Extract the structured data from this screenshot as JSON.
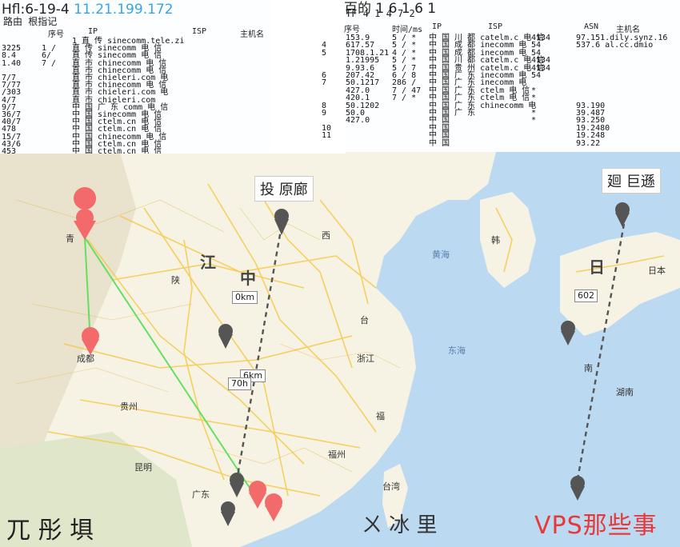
{
  "left_panel": {
    "title": "Hfl:6-19-4",
    "ip": "11.21.199.172",
    "subtitle": "路由 根指记",
    "headers": [
      "序号",
      "IP",
      "ISP",
      "主机名"
    ],
    "rows": [
      {
        "c1": "",
        "c2": "",
        "c3": "",
        "c4": "1 直 传 sinecomm.tele.zi"
      },
      {
        "c1": "3225",
        "c2": "1 /",
        "c3": "",
        "c4": "直 传 sinecomm 电 信"
      },
      {
        "c1": "8.4",
        "c2": "6/",
        "c3": "",
        "c4": "直 传 sinecomm 电 信"
      },
      {
        "c1": "1.40",
        "c2": "7 /",
        "c3": "",
        "c4": "直 市 chinecomm 电 信"
      },
      {
        "c1": "",
        "c2": "",
        "c3": "",
        "c4": "直 市 chinecomm 电 信"
      },
      {
        "c1": "7/7",
        "c2": "",
        "c3": "",
        "c4": "直 市 chieleri.com 电"
      },
      {
        "c1": "7/77",
        "c2": "",
        "c3": "",
        "c4": "直 市 chinecomm 电 信"
      },
      {
        "c1": "/303",
        "c2": "",
        "c3": "",
        "c4": "直 市 chieleri.com 电"
      },
      {
        "c1": "4/7",
        "c2": "",
        "c3": "",
        "c4": "直 市 chieleri.com"
      },
      {
        "c1": "9/7",
        "c2": "",
        "c3": "",
        "c4": "中 国 广 东 comm 电 信"
      },
      {
        "c1": "36/7",
        "c2": "",
        "c3": "",
        "c4": "中 国 sinecomm 电 信"
      },
      {
        "c1": "40/7",
        "c2": "",
        "c3": "",
        "c4": "中 国 ctelm.cn 电 信"
      },
      {
        "c1": "478",
        "c2": "",
        "c3": "",
        "c4": "中 国 ctelm.cn 电 信"
      },
      {
        "c1": "15/7",
        "c2": "",
        "c3": "",
        "c4": "中 国 chinecomm 电 信"
      },
      {
        "c1": "43/6",
        "c2": "",
        "c3": "",
        "c4": "中 国 ctelm.cn 电 信"
      },
      {
        "c1": "453",
        "c2": "",
        "c3": "",
        "c4": "中 国 ctelm.cn 电 信"
      }
    ]
  },
  "right_panel": {
    "title": "百的 1 6 1 6 1",
    "subtitle": "TF 4 1 4 7 2",
    "headers": [
      "序号",
      "时间/ms",
      "IP",
      "ISP",
      "ASN",
      "主机名"
    ],
    "rows": [
      {
        "n": "",
        "t": "153.9",
        "ip": "5 / *",
        "isp": "中 国 川 都 catelm.c 电 信",
        "asn": "4134",
        "host": "97.151.dily.synz.16"
      },
      {
        "n": "4",
        "t": "617.57",
        "ip": "5 / *",
        "isp": "中 国 成 都 inecomm 电",
        "asn": "54",
        "host": "537.6 al.cc.dmio"
      },
      {
        "n": "5",
        "t": "1708.1.21",
        "ip": "4 / *",
        "isp": "中 国 成 都 inecomm 电",
        "asn": "54",
        "host": ""
      },
      {
        "n": "",
        "t": "1.21995",
        "ip": "5 / *",
        "isp": "中 国 川 都 catelm.c 电 信",
        "asn": "4134",
        "host": ""
      },
      {
        "n": "",
        "t": "9.93.6",
        "ip": "5 / 7",
        "isp": "中 国 贵 州 catelm.c 电 信",
        "asn": "4134",
        "host": ""
      },
      {
        "n": "6",
        "t": "207.42",
        "ip": "6 / 8",
        "isp": "中 国 广 东 inecomm 电",
        "asn": "54",
        "host": ""
      },
      {
        "n": "7",
        "t": "50.1217",
        "ip": "286 /",
        "isp": "中 国 广 东 inecomm 电",
        "asn": "",
        "host": ""
      },
      {
        "n": "",
        "t": "427.0",
        "ip": "7 / 47",
        "isp": "中 国 广 东 ctelm 电 信",
        "asn": "*",
        "host": ""
      },
      {
        "n": "",
        "t": "420.1",
        "ip": "7 / *",
        "isp": "中 国 广 东 ctelm 电 信",
        "asn": "*",
        "host": ""
      },
      {
        "n": "8",
        "t": "50.1202",
        "ip": "",
        "isp": "中 国 广 东 chinecomm 电",
        "asn": "",
        "host": "93.190"
      },
      {
        "n": "9",
        "t": "50.0",
        "ip": "",
        "isp": "中 国 广 东",
        "asn": "*",
        "host": "39.487"
      },
      {
        "n": "",
        "t": "427.0",
        "ip": "",
        "isp": "中 国",
        "asn": "*",
        "host": "93.250"
      },
      {
        "n": "10",
        "t": "",
        "ip": "",
        "isp": "中 国",
        "asn": "",
        "host": "19.2480"
      },
      {
        "n": "11",
        "t": "",
        "ip": "",
        "isp": "中 国",
        "asn": "",
        "host": "19.248"
      },
      {
        "n": "",
        "t": "",
        "ip": "",
        "isp": "中 国",
        "asn": "",
        "host": "93.22"
      }
    ]
  },
  "map": {
    "labels": {
      "left_top": "投",
      "left_top2": "原廊",
      "right_top": "廻",
      "right_top2": "巨遜",
      "dist_1": "0km",
      "dist_2": "6km",
      "dist_3": "70h",
      "dist_4": "602"
    },
    "places": {
      "p1": "青",
      "p2": "中",
      "p3": "江",
      "p4": "日",
      "p5": "台",
      "p6": "昆明",
      "p7": "成都",
      "p8": "西",
      "p9": "湖南",
      "p10": "福",
      "p11": "浙江",
      "p12": "陕",
      "p13": "韩",
      "p14": "日本",
      "p15": "南",
      "p16": "东海",
      "p17": "黄海",
      "p18": "贵州",
      "p19": "广东",
      "p20": "福州",
      "p21": "台湾"
    },
    "watermark_left": "兀 彤 埧",
    "watermark_mid": "ㄨ 冰 里",
    "watermark": "VPS那些事",
    "colors": {
      "land": "#f6f3e4",
      "sea": "#bcd9f2",
      "road": "#f6c94a",
      "route_green": "#63e063",
      "route_dark": "#555555",
      "marker_red": "#f36a6a",
      "marker_dark": "#555555"
    }
  }
}
